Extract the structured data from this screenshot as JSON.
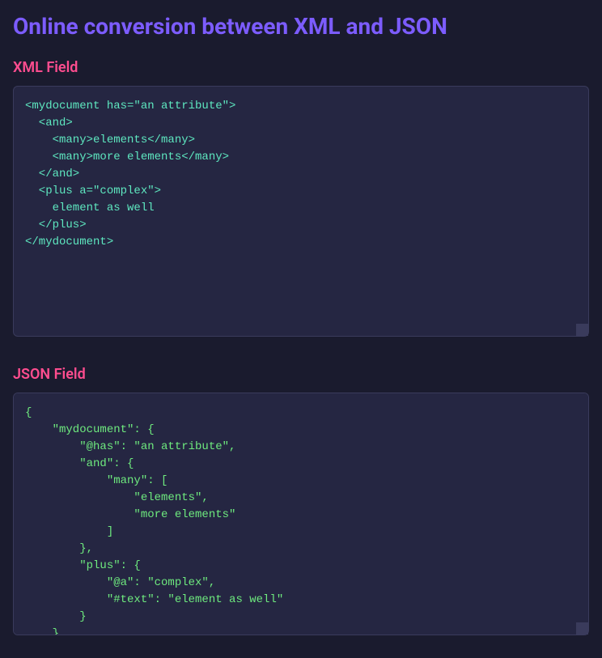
{
  "page": {
    "title": "Online conversion between XML and JSON"
  },
  "xml": {
    "label": "XML Field",
    "content": "<mydocument has=\"an attribute\">\n  <and>\n    <many>elements</many>\n    <many>more elements</many>\n  </and>\n  <plus a=\"complex\">\n    element as well\n  </plus>\n</mydocument>"
  },
  "json": {
    "label": "JSON Field",
    "content": "{\n    \"mydocument\": {\n        \"@has\": \"an attribute\",\n        \"and\": {\n            \"many\": [\n                \"elements\",\n                \"more elements\"\n            ]\n        },\n        \"plus\": {\n            \"@a\": \"complex\",\n            \"#text\": \"element as well\"\n        }\n    }\n}"
  }
}
